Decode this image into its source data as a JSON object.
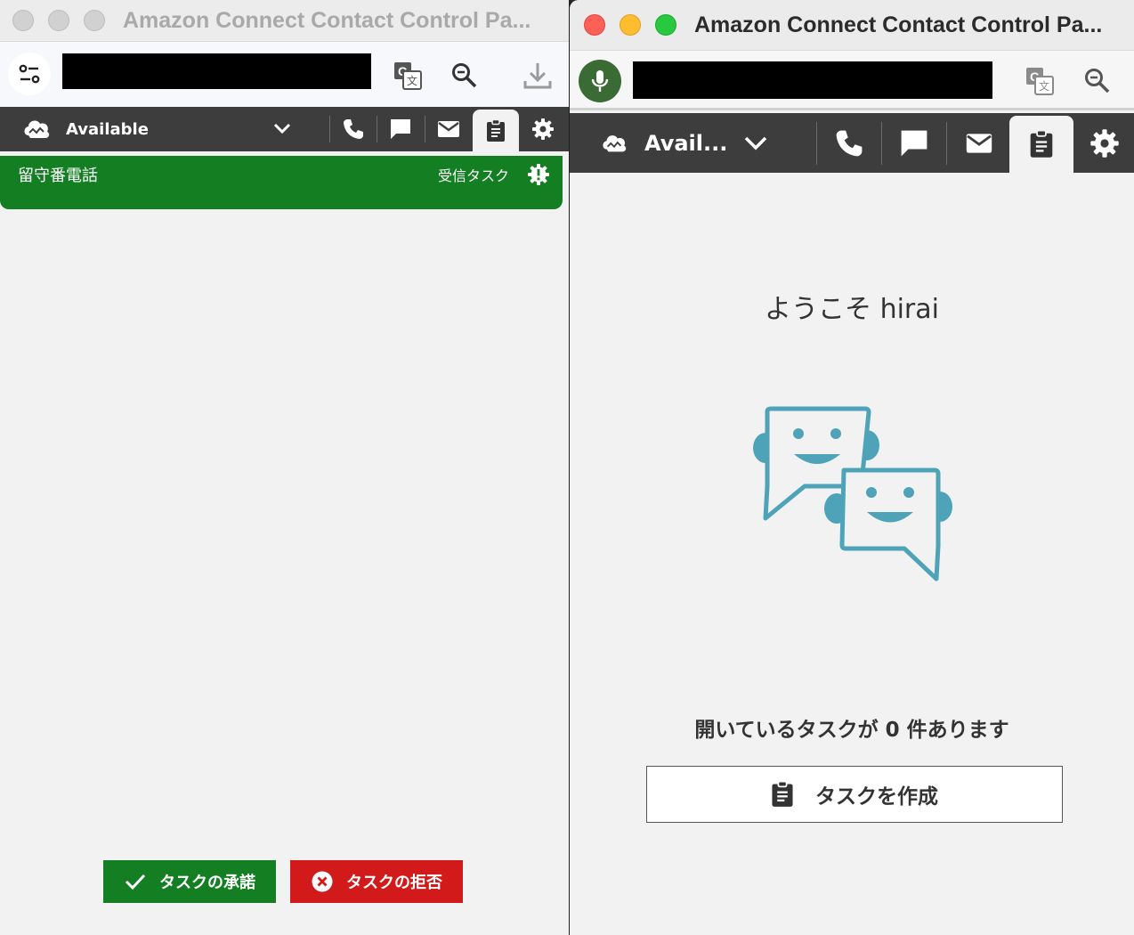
{
  "left_window": {
    "title": "Amazon Connect Contact Control Pa...",
    "nav": {
      "status_label": "Available"
    },
    "task": {
      "name": "留守番電話",
      "type_label": "受信タスク"
    },
    "actions": {
      "accept_label": "タスクの承諾",
      "reject_label": "タスクの拒否"
    }
  },
  "right_window": {
    "title": "Amazon Connect Contact Control Pa...",
    "nav": {
      "status_label": "Avail..."
    },
    "welcome": "ようこそ hirai",
    "open_tasks": "開いているタスクが 0 件あります",
    "create_task_label": "タスクを作成"
  },
  "colors": {
    "accept_green": "#137f22",
    "reject_red": "#d21a1a",
    "nav_dark": "#3d3d3d",
    "illustration_teal": "#4fa3b8",
    "mic_green": "#3b6b35"
  },
  "icons": [
    "controls-icon",
    "translate-icon",
    "zoom-icon",
    "download-icon",
    "microphone-icon",
    "cloud-status-icon",
    "chevron-down-icon",
    "phone-icon",
    "chat-icon",
    "email-icon",
    "task-icon",
    "gear-icon",
    "alert-icon",
    "check-icon",
    "close-circle-icon"
  ]
}
